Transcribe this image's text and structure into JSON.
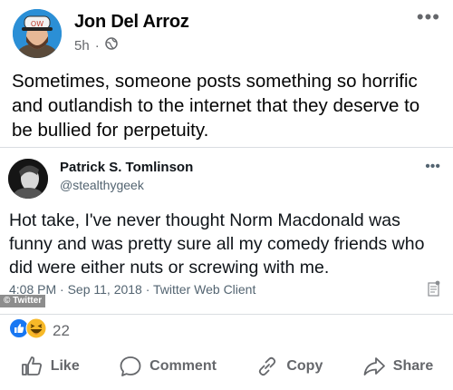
{
  "post": {
    "author_name": "Jon Del Arroz",
    "timestamp": "5h",
    "separator": "·",
    "privacy_icon": "globe-icon",
    "more_icon": "•••",
    "text": "Sometimes, someone posts something so horrific and outlandish to the internet that they deserve to be bullied for perpetuity.",
    "avatar_hat_text": "OW"
  },
  "embed": {
    "name": "Patrick S. Tomlinson",
    "handle": "@stealthygeek",
    "more_icon": "•••",
    "text": "Hot take, I've never thought Norm Macdonald was funny and was pretty sure all my comedy friends who did were either nuts or screwing with me.",
    "meta": "4:08 PM · Sep 11, 2018 · Twitter Web Client",
    "source_tag": "© Twitter"
  },
  "reactions": {
    "count": "22",
    "icons": [
      "like-reaction-icon",
      "haha-reaction-icon"
    ]
  },
  "actions": {
    "like": "Like",
    "comment": "Comment",
    "copy": "Copy",
    "share": "Share"
  },
  "colors": {
    "secondary_text": "#65676b",
    "like_blue": "#1877f2",
    "haha_yellow": "#f7b928"
  }
}
